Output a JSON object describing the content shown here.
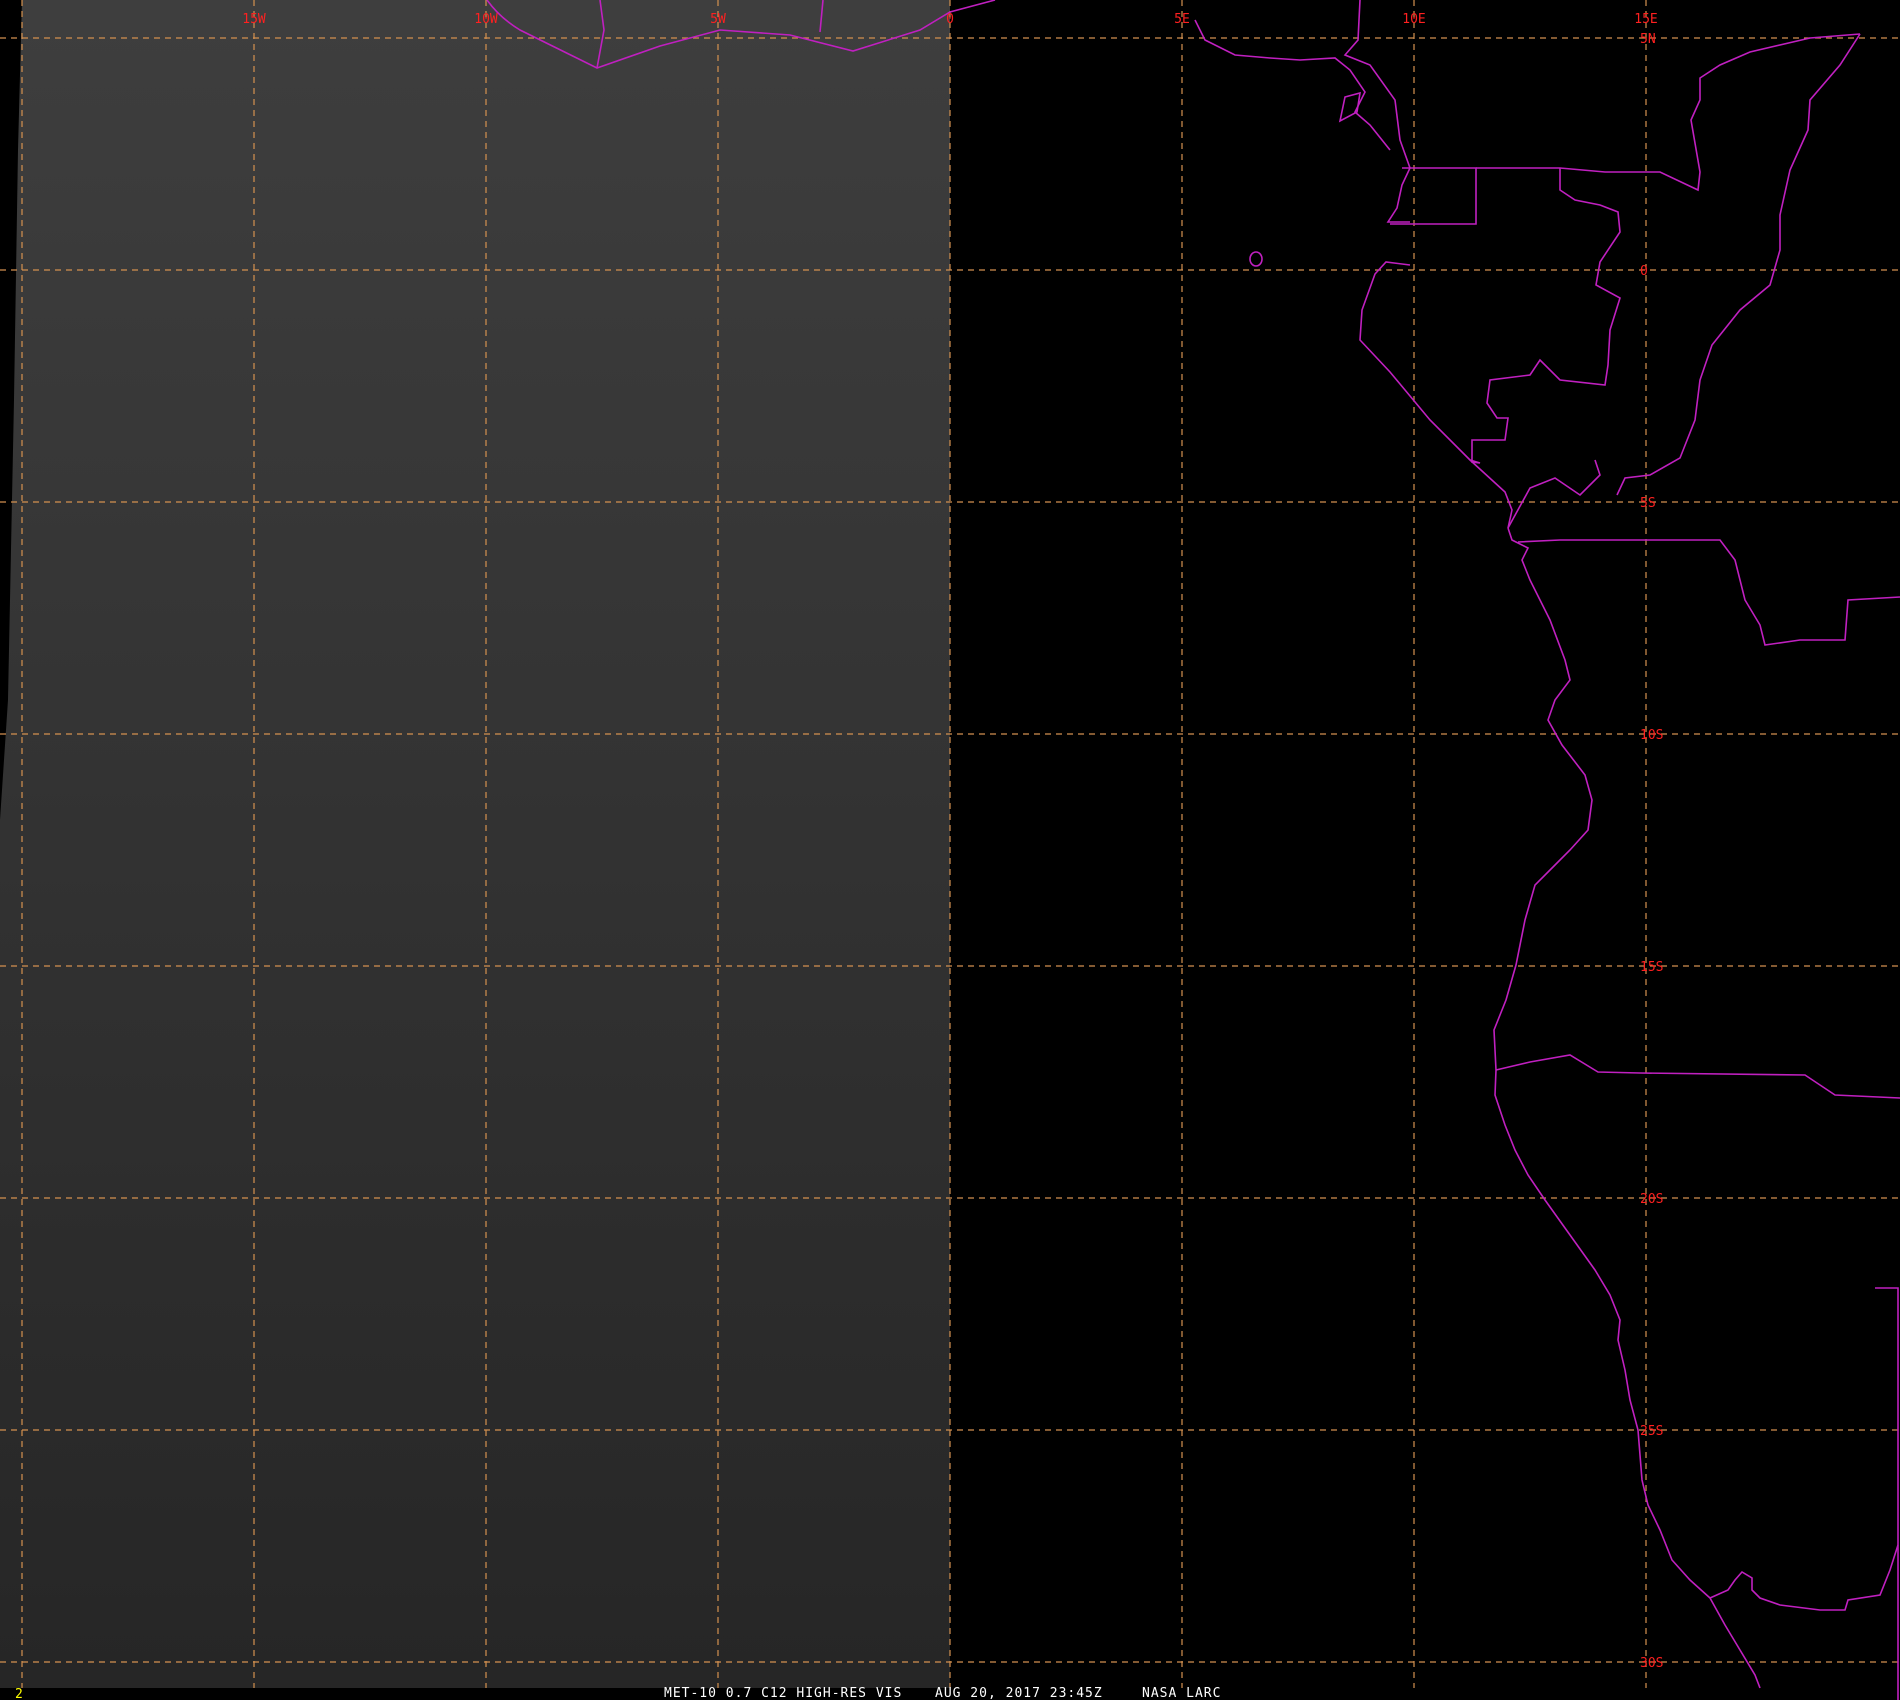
{
  "map": {
    "colors": {
      "background": "#000000",
      "grid": "#d4914f",
      "coastline": "#c020c0",
      "grid_label": "#ff2020",
      "caption": "#ffffff",
      "frame_number": "#ffff00"
    },
    "longitude_labels": [
      "15W",
      "10W",
      "5W",
      "0",
      "5E",
      "10E",
      "15E"
    ],
    "latitude_labels": [
      "5N",
      "0",
      "5S",
      "10S",
      "15S",
      "20S",
      "25S",
      "30S"
    ],
    "frame_number": "2",
    "caption": {
      "product": "MET-10 0.7 C12 HIGH-RES VIS",
      "datetime": "AUG 20, 2017 23:45Z",
      "source": "NASA LARC"
    }
  }
}
